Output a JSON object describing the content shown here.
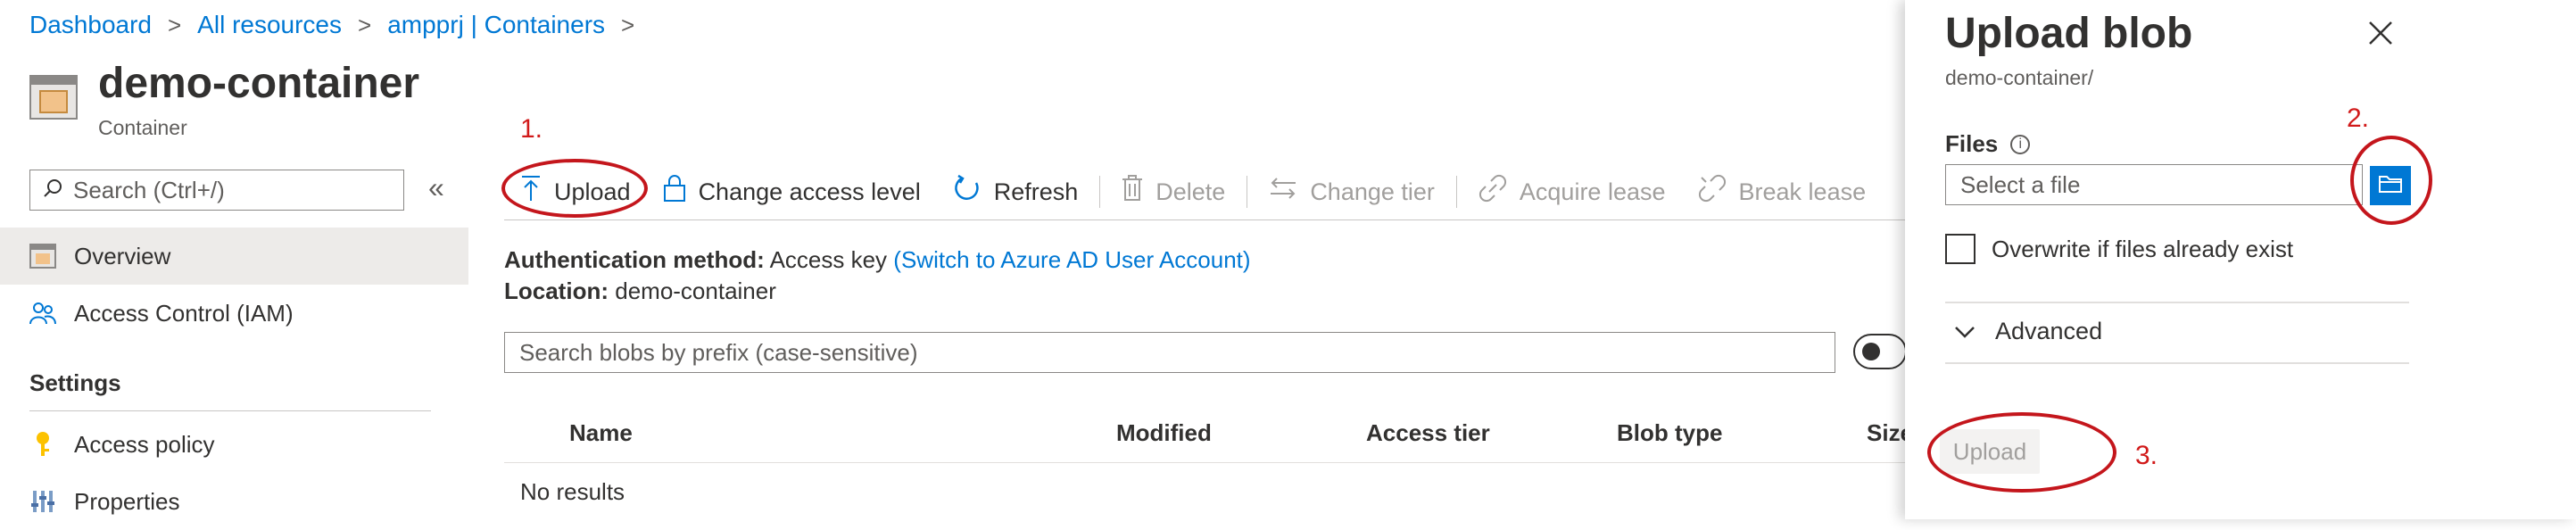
{
  "breadcrumb": {
    "items": [
      "Dashboard",
      "All resources",
      "ampprj | Containers"
    ],
    "separator": ">"
  },
  "header": {
    "title": "demo-container",
    "subtitle": "Container"
  },
  "sidebar": {
    "search_placeholder": "Search (Ctrl+/)",
    "collapse_glyph": "«",
    "items": [
      {
        "label": "Overview",
        "icon": "container-icon",
        "active": true
      },
      {
        "label": "Access Control (IAM)",
        "icon": "people-icon",
        "active": false
      }
    ],
    "settings_heading": "Settings",
    "settings_items": [
      {
        "label": "Access policy",
        "icon": "key-icon"
      },
      {
        "label": "Properties",
        "icon": "properties-icon"
      }
    ]
  },
  "toolbar": {
    "upload": "Upload",
    "change_access": "Change access level",
    "refresh": "Refresh",
    "delete": "Delete",
    "change_tier": "Change tier",
    "acquire_lease": "Acquire lease",
    "break_lease": "Break lease"
  },
  "info": {
    "auth_label": "Authentication method:",
    "auth_value": "Access key",
    "auth_link": "(Switch to Azure AD User Account)",
    "location_label": "Location:",
    "location_value": "demo-container"
  },
  "blob_search": {
    "placeholder": "Search blobs by prefix (case-sensitive)"
  },
  "table": {
    "columns": [
      "Name",
      "Modified",
      "Access tier",
      "Blob type",
      "Size"
    ],
    "empty_text": "No results"
  },
  "annotations": {
    "step1": "1.",
    "step2": "2.",
    "step3": "3.",
    "color": "#c4161c"
  },
  "panel": {
    "title": "Upload blob",
    "path": "demo-container/",
    "files_label": "Files",
    "file_placeholder": "Select a file",
    "overwrite_label": "Overwrite if files already exist",
    "advanced_label": "Advanced",
    "upload_button": "Upload"
  },
  "colors": {
    "accent": "#0078d4",
    "annotation": "#c4161c",
    "disabled": "#a19f9d"
  }
}
